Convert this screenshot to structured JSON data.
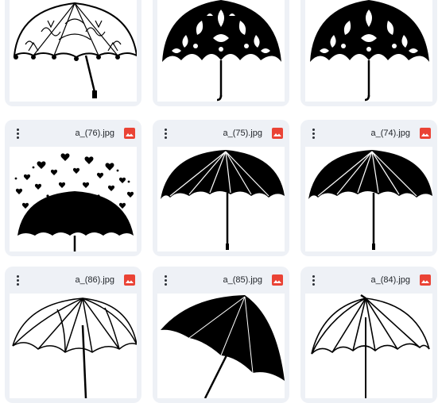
{
  "files": [
    {
      "name": ""
    },
    {
      "name": ""
    },
    {
      "name": ""
    },
    {
      "name": "a_(76).jpg"
    },
    {
      "name": "a_(75).jpg"
    },
    {
      "name": "a_(74).jpg"
    },
    {
      "name": "a_(86).jpg"
    },
    {
      "name": "a_(85).jpg"
    },
    {
      "name": "a_(84).jpg"
    }
  ],
  "icons": {
    "menu": "more-vert-icon",
    "file_type": "image-file-icon"
  },
  "colors": {
    "card_background": "#eef1f6",
    "file_type_icon": "#ea4335",
    "thumbnail_background": "#ffffff"
  }
}
